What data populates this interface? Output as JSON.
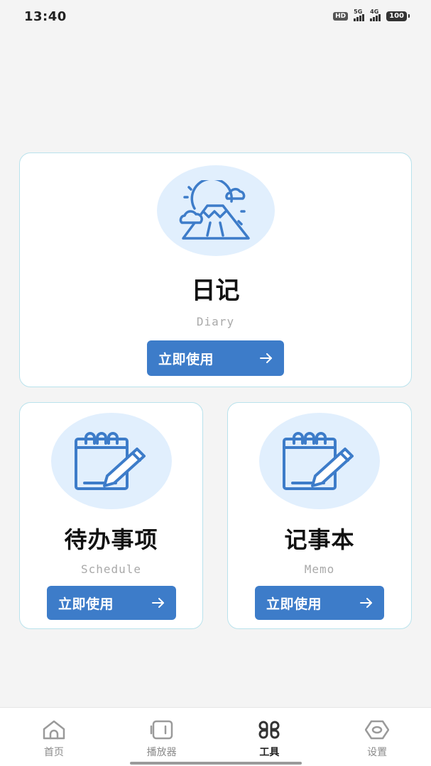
{
  "status_bar": {
    "time": "13:40",
    "hd": "HD",
    "net1": "5G",
    "net2": "4G",
    "battery": "100"
  },
  "cards": {
    "diary": {
      "title": "日记",
      "subtitle": "Diary",
      "button": "立即使用",
      "icon": "mountain-sun-icon"
    },
    "schedule": {
      "title": "待办事项",
      "subtitle": "Schedule",
      "button": "立即使用",
      "icon": "notepad-pencil-icon"
    },
    "memo": {
      "title": "记事本",
      "subtitle": "Memo",
      "button": "立即使用",
      "icon": "notepad-pencil-icon"
    }
  },
  "nav": {
    "items": [
      {
        "label": "首页",
        "icon": "home-icon",
        "active": false
      },
      {
        "label": "播放器",
        "icon": "player-icon",
        "active": false
      },
      {
        "label": "工具",
        "icon": "tools-grid-icon",
        "active": true
      },
      {
        "label": "设置",
        "icon": "settings-eye-icon",
        "active": false
      }
    ]
  },
  "colors": {
    "accent": "#3d7cc9",
    "icon_bg": "#e1effd",
    "card_border": "#b9e2ec",
    "page_bg": "#f4f4f4"
  }
}
